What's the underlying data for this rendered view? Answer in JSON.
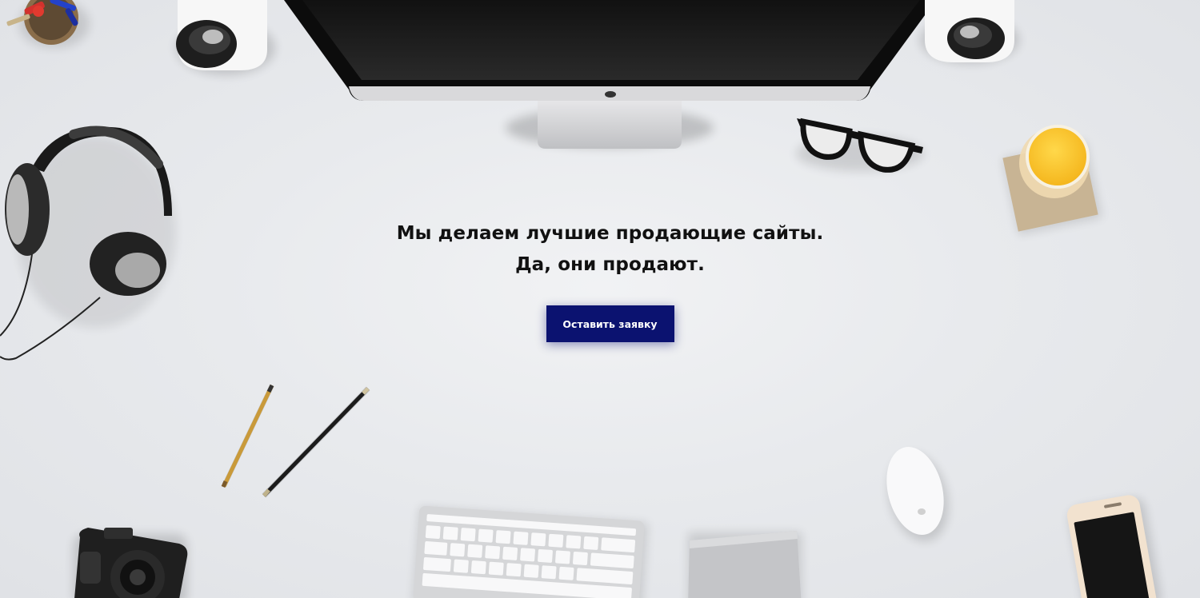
{
  "hero": {
    "headline_line1": "Мы делаем лучшие продающие сайты.",
    "headline_line2": "Да, они продают.",
    "cta_label": "Оставить заявку"
  },
  "colors": {
    "background": "#e8eaed",
    "cta_background": "#0b1270",
    "cta_text": "#ffffff",
    "headline_text": "#111111"
  },
  "scene_objects": [
    "pen-cup-icon",
    "speaker-left-icon",
    "imac-monitor-icon",
    "speaker-right-icon",
    "headphones-icon",
    "glasses-icon",
    "juice-glass-icon",
    "pencil-icon",
    "pencil-icon",
    "camera-icon",
    "keyboard-icon",
    "trackpad-icon",
    "mouse-icon",
    "smartphone-icon"
  ]
}
